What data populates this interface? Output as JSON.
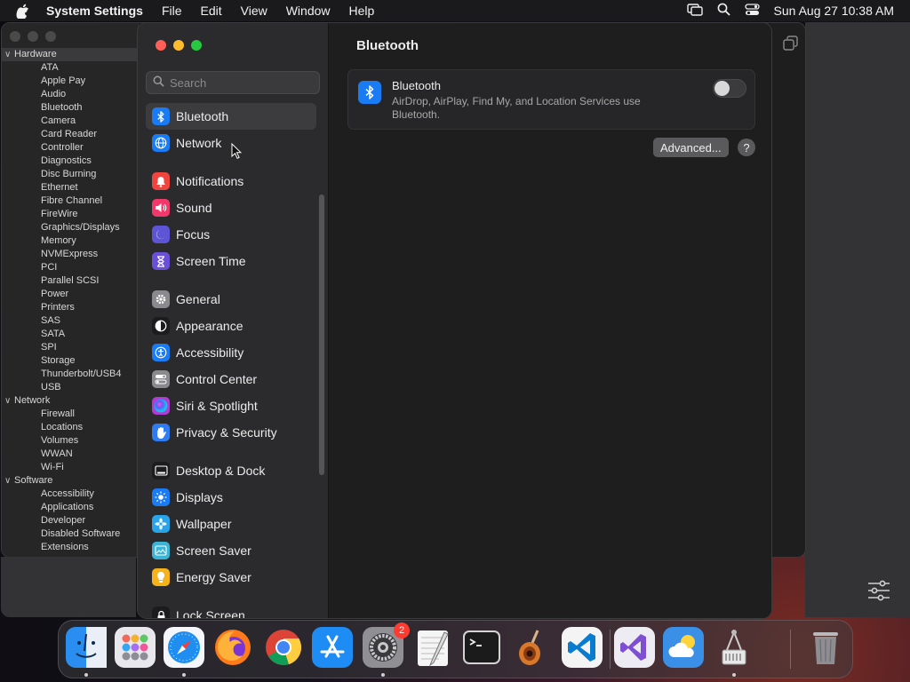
{
  "menubar": {
    "app_name": "System Settings",
    "menus": [
      "File",
      "Edit",
      "View",
      "Window",
      "Help"
    ],
    "clock": "Sun Aug 27  10:38 AM"
  },
  "system_info_tree": [
    {
      "type": "category",
      "label": "Hardware"
    },
    {
      "type": "item",
      "label": "ATA"
    },
    {
      "type": "item",
      "label": "Apple Pay"
    },
    {
      "type": "item",
      "label": "Audio"
    },
    {
      "type": "item",
      "label": "Bluetooth"
    },
    {
      "type": "item",
      "label": "Camera"
    },
    {
      "type": "item",
      "label": "Card Reader"
    },
    {
      "type": "item",
      "label": "Controller"
    },
    {
      "type": "item",
      "label": "Diagnostics"
    },
    {
      "type": "item",
      "label": "Disc Burning"
    },
    {
      "type": "item",
      "label": "Ethernet"
    },
    {
      "type": "item",
      "label": "Fibre Channel"
    },
    {
      "type": "item",
      "label": "FireWire"
    },
    {
      "type": "item",
      "label": "Graphics/Displays"
    },
    {
      "type": "item",
      "label": "Memory"
    },
    {
      "type": "item",
      "label": "NVMExpress"
    },
    {
      "type": "item",
      "label": "PCI"
    },
    {
      "type": "item",
      "label": "Parallel SCSI"
    },
    {
      "type": "item",
      "label": "Power"
    },
    {
      "type": "item",
      "label": "Printers"
    },
    {
      "type": "item",
      "label": "SAS"
    },
    {
      "type": "item",
      "label": "SATA"
    },
    {
      "type": "item",
      "label": "SPI"
    },
    {
      "type": "item",
      "label": "Storage"
    },
    {
      "type": "item",
      "label": "Thunderbolt/USB4"
    },
    {
      "type": "item",
      "label": "USB"
    },
    {
      "type": "category",
      "label": "Network"
    },
    {
      "type": "item",
      "label": "Firewall"
    },
    {
      "type": "item",
      "label": "Locations"
    },
    {
      "type": "item",
      "label": "Volumes"
    },
    {
      "type": "item",
      "label": "WWAN"
    },
    {
      "type": "item",
      "label": "Wi-Fi"
    },
    {
      "type": "category",
      "label": "Software"
    },
    {
      "type": "item",
      "label": "Accessibility"
    },
    {
      "type": "item",
      "label": "Applications"
    },
    {
      "type": "item",
      "label": "Developer"
    },
    {
      "type": "item",
      "label": "Disabled Software"
    },
    {
      "type": "item",
      "label": "Extensions"
    }
  ],
  "settings": {
    "search_placeholder": "Search",
    "nav": [
      {
        "label": "Bluetooth",
        "icon": "bluetooth-icon",
        "color": "#1a7cf5",
        "selected": true,
        "gap_before": false
      },
      {
        "label": "Network",
        "icon": "globe-icon",
        "color": "#1a7cf5",
        "selected": false,
        "gap_before": false
      },
      {
        "label": "Notifications",
        "icon": "bell-icon",
        "color": "#f0453f",
        "selected": false,
        "gap_before": true
      },
      {
        "label": "Sound",
        "icon": "speaker-icon",
        "color": "#f0386a",
        "selected": false,
        "gap_before": false
      },
      {
        "label": "Focus",
        "icon": "moon-icon",
        "color": "#5d55d6",
        "selected": false,
        "gap_before": false
      },
      {
        "label": "Screen Time",
        "icon": "hourglass-icon",
        "color": "#6a4fd8",
        "selected": false,
        "gap_before": false
      },
      {
        "label": "General",
        "icon": "gear-icon",
        "color": "#8a8a8e",
        "selected": false,
        "gap_before": true
      },
      {
        "label": "Appearance",
        "icon": "appearance-icon",
        "color": "#1c1c1e",
        "selected": false,
        "gap_before": false
      },
      {
        "label": "Accessibility",
        "icon": "accessibility-icon",
        "color": "#1a7cf5",
        "selected": false,
        "gap_before": false
      },
      {
        "label": "Control Center",
        "icon": "toggles-icon",
        "color": "#8a8a8e",
        "selected": false,
        "gap_before": false
      },
      {
        "label": "Siri & Spotlight",
        "icon": "siri-icon",
        "color": "#b23bd4",
        "selected": false,
        "gap_before": false
      },
      {
        "label": "Privacy & Security",
        "icon": "hand-icon",
        "color": "#2f7bf0",
        "selected": false,
        "gap_before": false
      },
      {
        "label": "Desktop & Dock",
        "icon": "dock-icon",
        "color": "#1c1c1e",
        "selected": false,
        "gap_before": true
      },
      {
        "label": "Displays",
        "icon": "sun-icon",
        "color": "#1a7cf5",
        "selected": false,
        "gap_before": false
      },
      {
        "label": "Wallpaper",
        "icon": "flower-icon",
        "color": "#2aa4e8",
        "selected": false,
        "gap_before": false
      },
      {
        "label": "Screen Saver",
        "icon": "screensaver-icon",
        "color": "#3ab5d6",
        "selected": false,
        "gap_before": false
      },
      {
        "label": "Energy Saver",
        "icon": "bulb-icon",
        "color": "#f6b21b",
        "selected": false,
        "gap_before": false
      },
      {
        "label": "Lock Screen",
        "icon": "lock-icon",
        "color": "#1c1c1e",
        "selected": false,
        "gap_before": true
      }
    ],
    "detail": {
      "title": "Bluetooth",
      "card_title": "Bluetooth",
      "card_desc": "AirDrop, AirPlay, Find My, and Location Services use Bluetooth.",
      "toggle_on": false,
      "advanced_label": "Advanced...",
      "help_label": "?"
    }
  },
  "dock": [
    {
      "name": "finder",
      "color": "#2a8ef0",
      "running": true
    },
    {
      "name": "launchpad",
      "color": "#e9e9ee",
      "running": false
    },
    {
      "name": "safari",
      "color": "#1f8ef0",
      "running": true
    },
    {
      "name": "firefox",
      "color": "#ff7a1a",
      "running": false
    },
    {
      "name": "chrome",
      "color": "#f1f1f1",
      "running": false
    },
    {
      "name": "app-store",
      "color": "#1d8cf4",
      "running": false
    },
    {
      "name": "system-settings",
      "color": "#8f8f94",
      "running": true,
      "badge": "2"
    },
    {
      "name": "textedit",
      "color": "#f5f5f5",
      "running": false
    },
    {
      "name": "terminal",
      "color": "#1b1b1b",
      "running": false
    },
    {
      "name": "garageband",
      "color": "#d8782a",
      "running": false
    },
    {
      "name": "vscode",
      "color": "#f4f4f4",
      "running": false
    },
    {
      "name": "visual-studio",
      "color": "#ececf2",
      "running": false
    },
    {
      "name": "weather",
      "color": "#3a8fe6",
      "running": false
    },
    {
      "name": "system-information",
      "color": "#f2f2f2",
      "running": true
    },
    {
      "name": "trash",
      "color": "#7d7d80",
      "running": false
    }
  ]
}
